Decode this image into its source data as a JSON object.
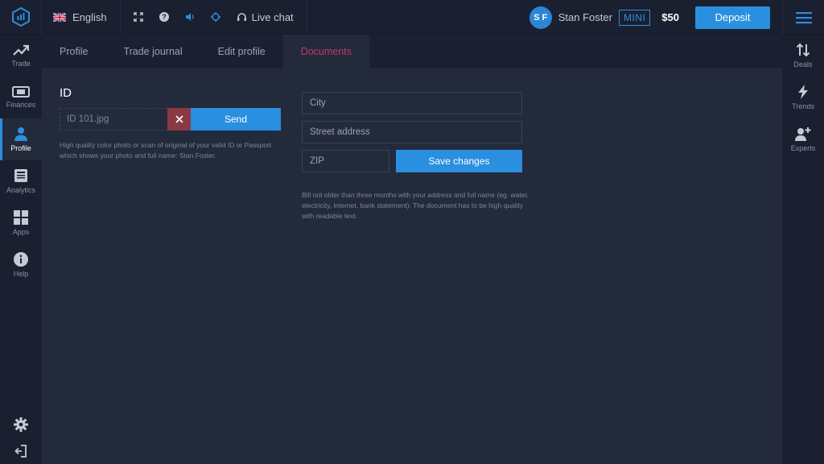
{
  "topbar": {
    "language": "English",
    "live_chat": "Live chat",
    "user_initials": "S F",
    "user_name": "Stan Foster",
    "account_badge": "MINI",
    "balance": "$50",
    "deposit_label": "Deposit"
  },
  "leftnav": {
    "items": [
      {
        "label": "Trade",
        "icon": "trend-up-icon"
      },
      {
        "label": "Finances",
        "icon": "banknote-icon"
      },
      {
        "label": "Profile",
        "icon": "user-icon"
      },
      {
        "label": "Analytics",
        "icon": "newspaper-icon"
      },
      {
        "label": "Apps",
        "icon": "grid-icon"
      },
      {
        "label": "Help",
        "icon": "info-icon"
      }
    ],
    "active": "Profile"
  },
  "rightnav": {
    "items": [
      {
        "label": "Deals",
        "icon": "swap-vertical-icon"
      },
      {
        "label": "Trends",
        "icon": "lightning-icon"
      },
      {
        "label": "Experts",
        "icon": "add-user-icon"
      }
    ]
  },
  "tabs": {
    "items": [
      "Profile",
      "Trade journal",
      "Edit profile",
      "Documents"
    ],
    "active": "Documents"
  },
  "id_section": {
    "title": "ID",
    "file_name": "ID 101.jpg",
    "send_label": "Send",
    "note": "High quality color photo or scan of original of your valid ID or Passport which shows your photo and full name: Stan Foster."
  },
  "address_section": {
    "city_placeholder": "City",
    "street_placeholder": "Street address",
    "zip_placeholder": "ZIP",
    "save_label": "Save changes",
    "note": "Bill not older than three months with your address and full name (eg. water, electricity, internet, bank statement). The document has to be high quality with readable text."
  },
  "colors": {
    "accent": "#2b8fe0",
    "active_tab": "#c0396b",
    "remove_button": "#8b3a44"
  }
}
